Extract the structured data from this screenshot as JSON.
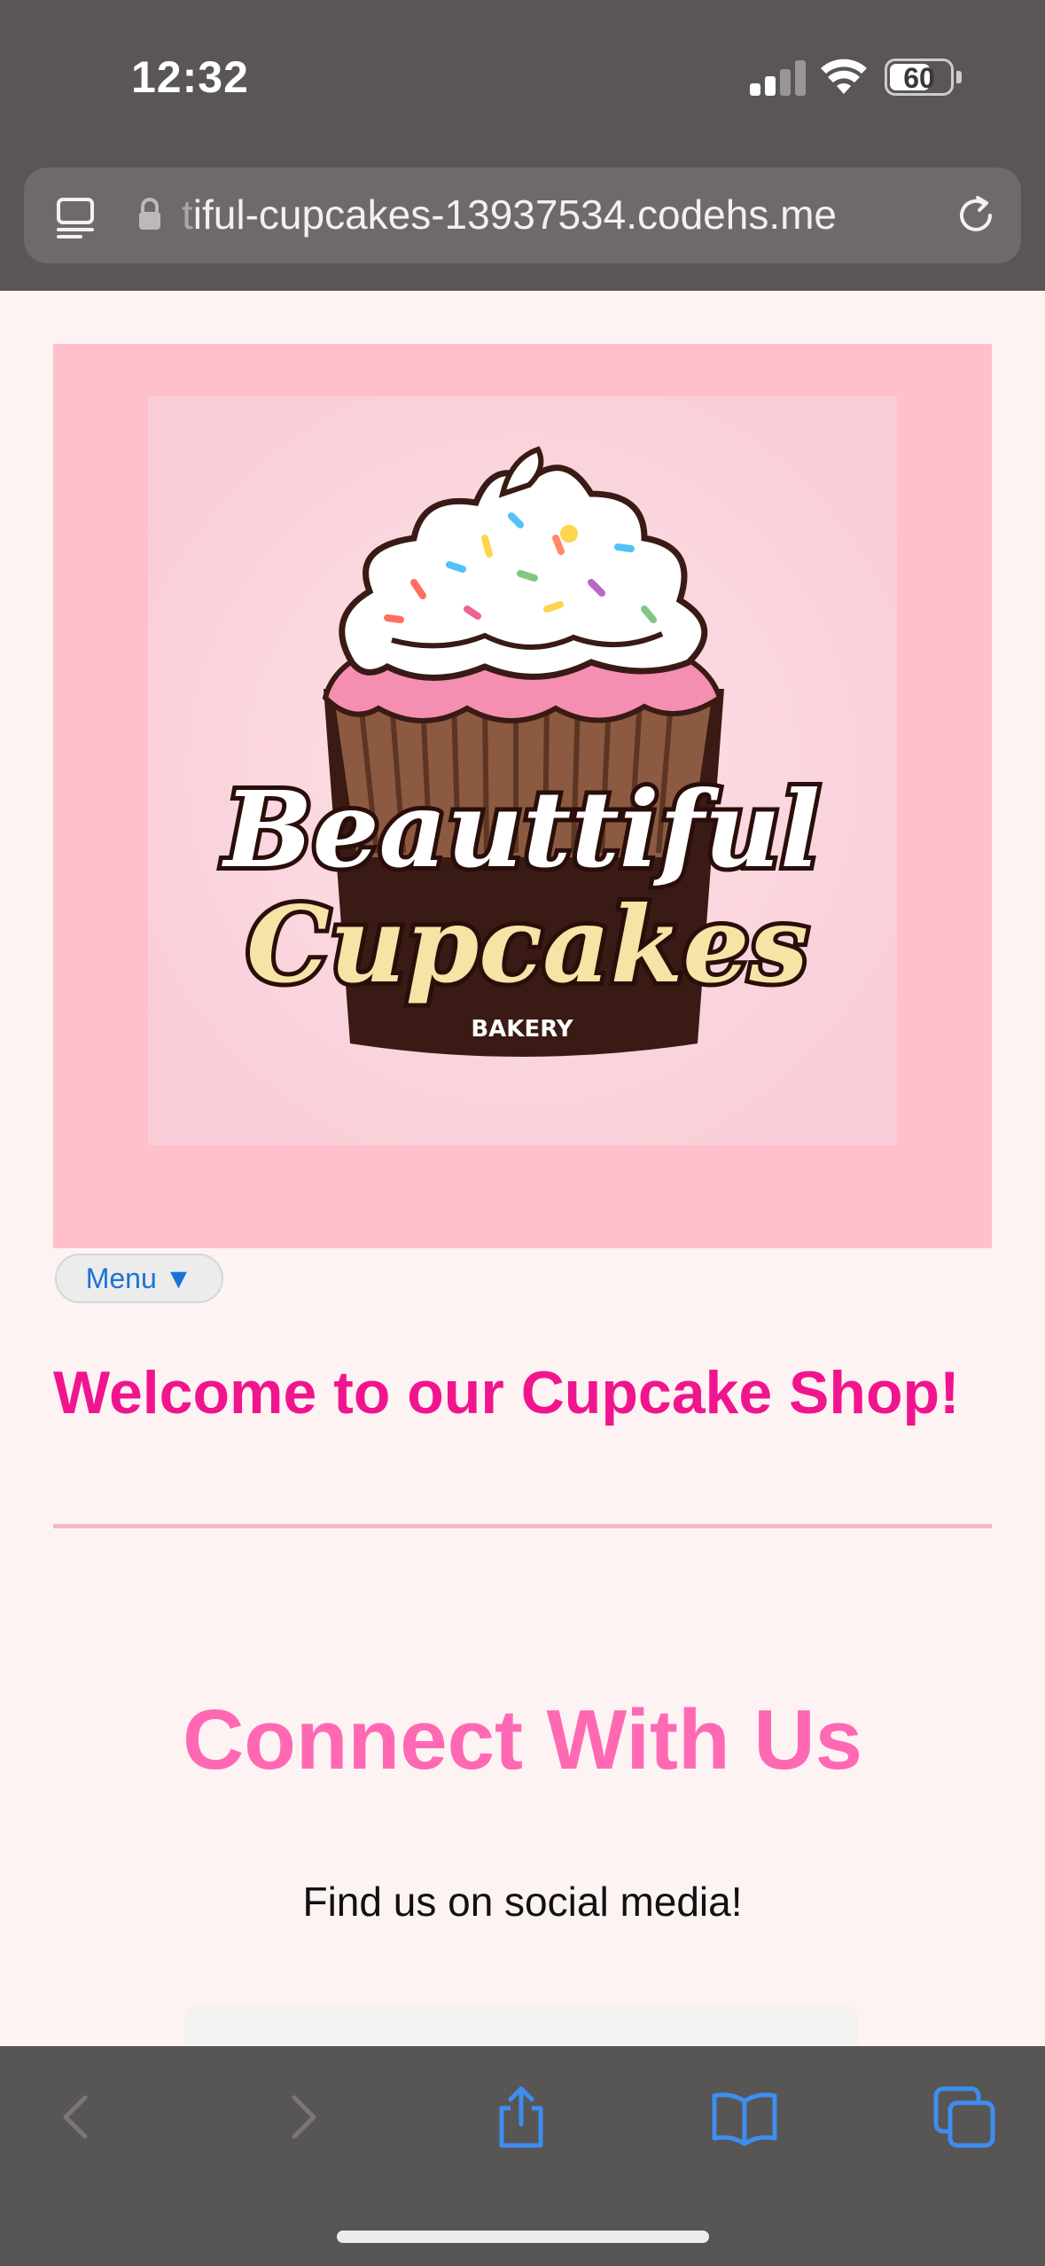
{
  "status_bar": {
    "time": "12:32",
    "battery": "60"
  },
  "browser": {
    "url_faded": "t",
    "url": "iful-cupcakes-13937534.codehs.me"
  },
  "hero": {
    "logo_line1": "Beauttiful",
    "logo_line2": "Cupcakes",
    "logo_line3": "BAKERY"
  },
  "menu": {
    "label": "Menu ▼"
  },
  "main": {
    "welcome_heading": "Welcome to our Cupcake Shop!",
    "connect_heading": "Connect With Us",
    "connect_subtext": "Find us on social media!"
  },
  "colors": {
    "heading_pink": "#f0158e",
    "connect_pink": "#ff69b4",
    "hero_bg": "#ffc0cb",
    "link_blue": "#1a73d6"
  }
}
